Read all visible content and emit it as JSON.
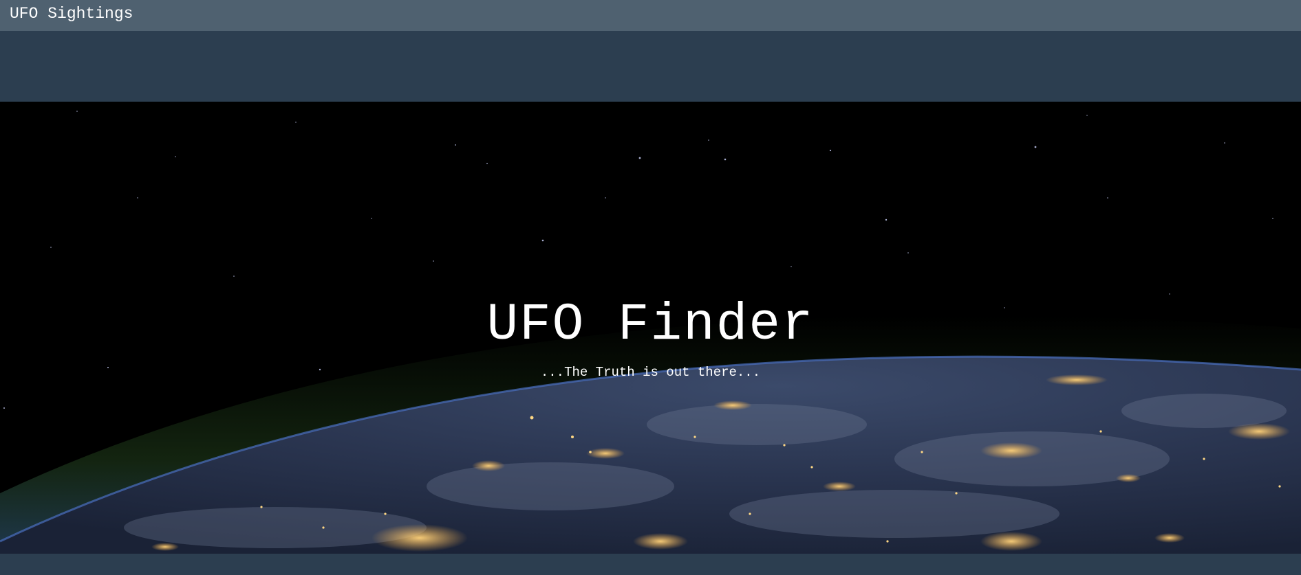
{
  "navbar": {
    "brand": "UFO Sightings"
  },
  "hero": {
    "title": "UFO Finder",
    "subtitle": "...The Truth is out there..."
  },
  "colors": {
    "navbar_bg": "#4f6170",
    "page_bg": "#2c3e50",
    "hero_bg": "#000000",
    "text": "#ffffff"
  }
}
